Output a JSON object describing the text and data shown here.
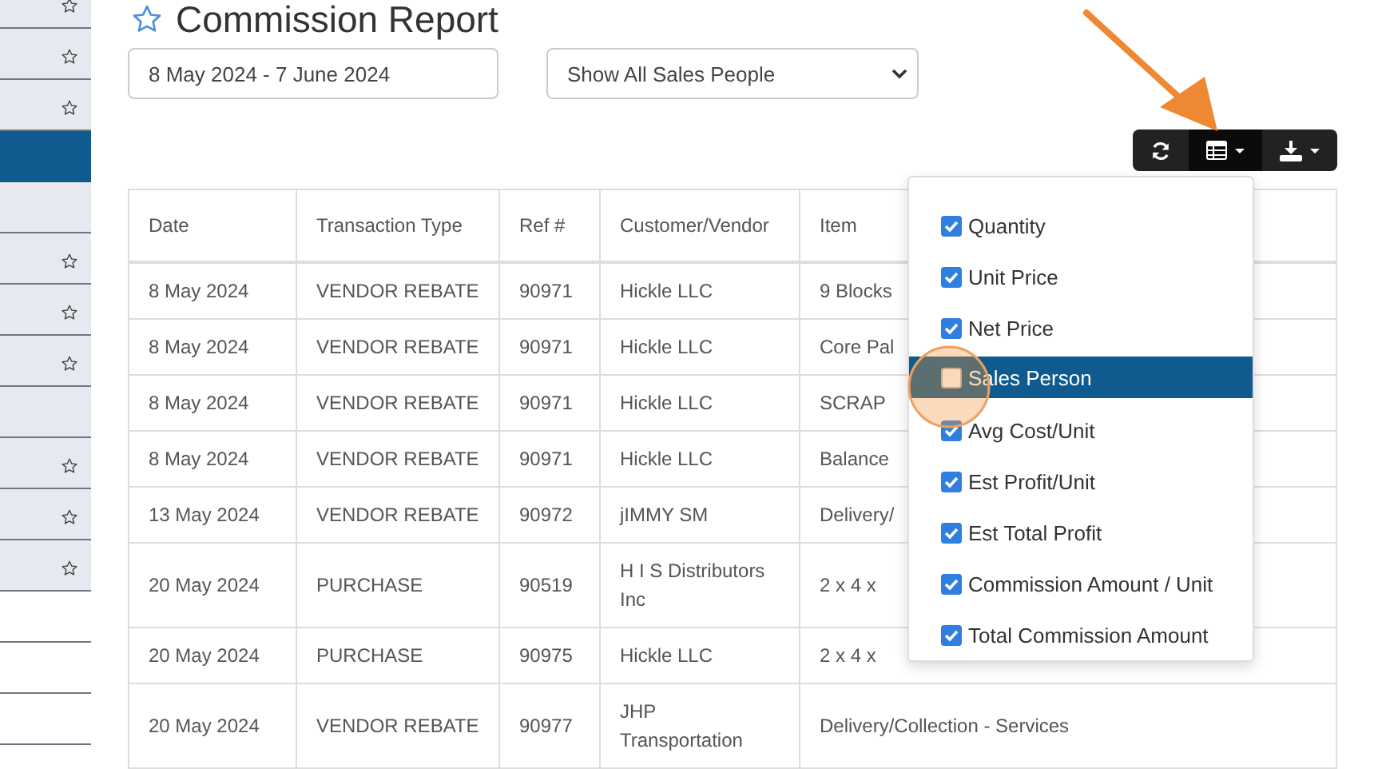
{
  "sidebar": {
    "items": [
      {
        "starred": true,
        "selected": false
      },
      {
        "starred": true,
        "selected": false
      },
      {
        "starred": true,
        "selected": false
      },
      {
        "starred": false,
        "selected": true
      },
      {
        "starred": false,
        "selected": false
      },
      {
        "starred": true,
        "selected": false
      },
      {
        "starred": true,
        "selected": false
      },
      {
        "starred": true,
        "selected": false
      },
      {
        "starred": false,
        "selected": false
      },
      {
        "starred": true,
        "selected": false
      },
      {
        "starred": true,
        "selected": false
      },
      {
        "starred": true,
        "selected": false
      },
      {
        "starred": false,
        "selected": false
      },
      {
        "starred": false,
        "selected": false
      },
      {
        "starred": false,
        "selected": false
      }
    ]
  },
  "title": "Commission Report",
  "filters": {
    "date_range": "8 May 2024 - 7 June 2024",
    "sales_person": "Show All Sales People"
  },
  "toolbar": {
    "buttons": [
      {
        "kind": "refresh",
        "selected": false,
        "caret": false
      },
      {
        "kind": "columns",
        "selected": true,
        "caret": true
      },
      {
        "kind": "export",
        "selected": false,
        "caret": true
      }
    ]
  },
  "table": {
    "columns": [
      "Date",
      "Transaction Type",
      "Ref #",
      "Customer/Vendor",
      "Item"
    ],
    "rows": [
      [
        "8 May 2024",
        "VENDOR REBATE",
        "90971",
        "Hickle LLC",
        "9 Blocks"
      ],
      [
        "8 May 2024",
        "VENDOR REBATE",
        "90971",
        "Hickle LLC",
        "Core Pal"
      ],
      [
        "8 May 2024",
        "VENDOR REBATE",
        "90971",
        "Hickle LLC",
        "SCRAP"
      ],
      [
        "8 May 2024",
        "VENDOR REBATE",
        "90971",
        "Hickle LLC",
        "Balance"
      ],
      [
        "13 May 2024",
        "VENDOR REBATE",
        "90972",
        "jIMMY SM",
        "Delivery/"
      ],
      [
        "20 May 2024",
        "PURCHASE",
        "90519",
        "H I S Distributors Inc",
        "2 x 4 x"
      ],
      [
        "20 May 2024",
        "PURCHASE",
        "90975",
        "Hickle LLC",
        "2 x 4 x"
      ],
      [
        "20 May 2024",
        "VENDOR REBATE",
        "90977",
        "JHP Transportation",
        "Delivery/Collection - Services"
      ]
    ]
  },
  "column_menu": {
    "items": [
      {
        "label": "Quantity",
        "checked": true,
        "selected": false
      },
      {
        "label": "Unit Price",
        "checked": true,
        "selected": false
      },
      {
        "label": "Net Price",
        "checked": true,
        "selected": false
      },
      {
        "label": "Sales Person",
        "checked": false,
        "selected": true
      },
      {
        "label": "Avg Cost/Unit",
        "checked": true,
        "selected": false
      },
      {
        "label": "Est Profit/Unit",
        "checked": true,
        "selected": false
      },
      {
        "label": "Est Total Profit",
        "checked": true,
        "selected": false
      },
      {
        "label": "Commission Amount / Unit",
        "checked": true,
        "selected": false
      },
      {
        "label": "Total Commission Amount",
        "checked": true,
        "selected": false
      }
    ]
  }
}
